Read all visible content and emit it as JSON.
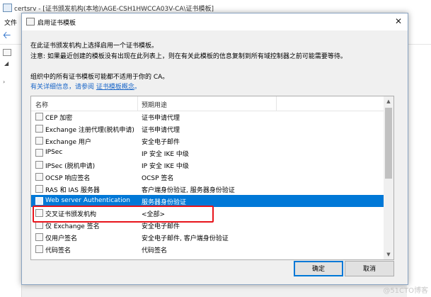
{
  "background_window": {
    "title": "certsrv - [证书颁发机构(本地)\\AGE-CSH1HWCCA03V-CA\\证书模板]",
    "menu_file": "文件",
    "back_icon": "back-arrow-icon"
  },
  "dialog": {
    "title": "启用证书模板",
    "close_glyph": "✕",
    "intro_text": "在此证书颁发机构上选择启用一个证书模板。",
    "note_text": "注意: 如果最近创建的模板没有出现在此列表上，则在有关此模板的信息复制到所有域控制器之前可能需要等待。",
    "org_note_text": "组织中的所有证书模板可能都不适用于你的 CA。",
    "more_info_prefix": "有关详细信息，请参阅",
    "more_info_link": "证书模板概念",
    "more_info_suffix": "。",
    "columns": {
      "name": "名称",
      "purpose": "预期用途"
    },
    "templates": [
      {
        "name": "CEP 加密",
        "purpose": "证书申请代理"
      },
      {
        "name": "Exchange 注册代理(脱机申请)",
        "purpose": "证书申请代理"
      },
      {
        "name": "Exchange 用户",
        "purpose": "安全电子邮件"
      },
      {
        "name": "IPSec",
        "purpose": "IP 安全 IKE 中级"
      },
      {
        "name": "IPSec (脱机申请)",
        "purpose": "IP 安全 IKE 中级"
      },
      {
        "name": "OCSP 响应签名",
        "purpose": "OCSP 签名"
      },
      {
        "name": "RAS 和 IAS 服务器",
        "purpose": "客户端身份验证, 服务器身份验证"
      },
      {
        "name": "Web server Authentication",
        "purpose": "服务器身份验证"
      },
      {
        "name": "交叉证书颁发机构",
        "purpose": "<全部>"
      },
      {
        "name": "仅 Exchange 签名",
        "purpose": "安全电子邮件"
      },
      {
        "name": "仅用户签名",
        "purpose": "安全电子邮件, 客户端身份验证"
      },
      {
        "name": "代码签名",
        "purpose": "代码签名"
      }
    ],
    "selected_index": 7,
    "ok_label": "确定",
    "cancel_label": "取消"
  },
  "watermark": "@51CTO博客",
  "colors": {
    "selection": "#0078d7",
    "highlight_box": "#e8141b",
    "link": "#1a66c8"
  }
}
